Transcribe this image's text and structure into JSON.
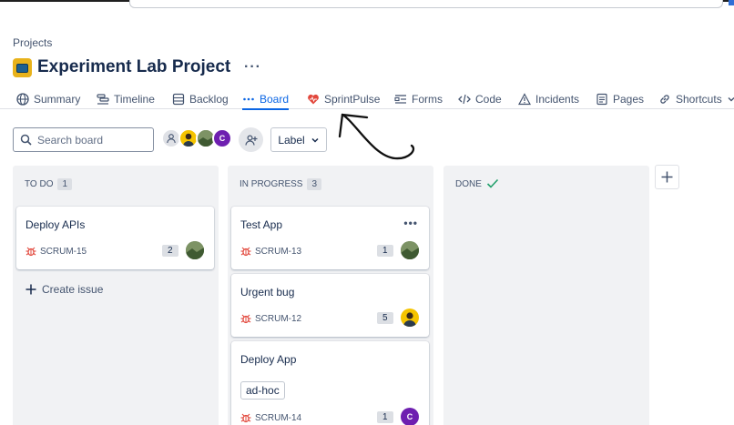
{
  "breadcrumb": "Projects",
  "project": {
    "title": "Experiment Lab Project",
    "more": "···"
  },
  "tabs": [
    {
      "label": "Summary",
      "icon": "globe-icon"
    },
    {
      "label": "Timeline",
      "icon": "timeline-icon"
    },
    {
      "label": "Backlog",
      "icon": "backlog-icon"
    },
    {
      "label": "Board",
      "icon": "more-dots-icon",
      "active": true
    },
    {
      "label": "SprintPulse",
      "icon": "heart-icon"
    },
    {
      "label": "Forms",
      "icon": "forms-icon"
    },
    {
      "label": "Code",
      "icon": "code-icon"
    },
    {
      "label": "Incidents",
      "icon": "warning-icon"
    },
    {
      "label": "Pages",
      "icon": "pages-icon"
    },
    {
      "label": "Shortcuts",
      "icon": "link-icon"
    }
  ],
  "search": {
    "placeholder": "Search board"
  },
  "avatar_purple_initials": "C",
  "label_filter": "Label",
  "columns": {
    "todo": {
      "title": "TO DO",
      "count": "1"
    },
    "inprogress": {
      "title": "IN PROGRESS",
      "count": "3"
    },
    "done": {
      "title": "DONE"
    }
  },
  "cards": {
    "todo_1": {
      "title": "Deploy APIs",
      "key": "SCRUM-15",
      "points": "2"
    },
    "ip_1": {
      "title": "Test App",
      "key": "SCRUM-13",
      "points": "1"
    },
    "ip_2": {
      "title": "Urgent bug",
      "key": "SCRUM-12",
      "points": "5"
    },
    "ip_3": {
      "title": "Deploy App",
      "tag": "ad-hoc",
      "key": "SCRUM-14",
      "points": "1"
    }
  },
  "create_issue": "Create issue",
  "colors": {
    "accent": "#0c66e4",
    "column_bg": "#f1f2f4",
    "bug": "#e2483d",
    "done_check": "#22a06b"
  }
}
